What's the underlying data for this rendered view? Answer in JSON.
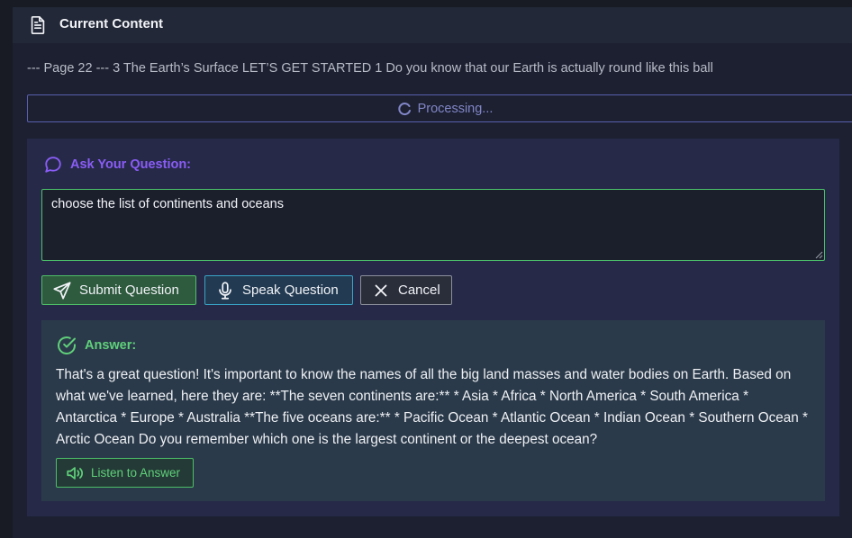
{
  "header": {
    "title": "Current Content",
    "icon": "document-icon"
  },
  "content": {
    "snippet": "--- Page 22 --- 3 The Earth’s Surface LET’S GET STARTED 1 Do you know that our Earth is actually round like this ball"
  },
  "status": {
    "processing_label": "Processing..."
  },
  "question": {
    "label": "Ask Your Question:",
    "value": "choose the list of continents and oceans"
  },
  "buttons": {
    "submit": "Submit Question",
    "speak": "Speak Question",
    "cancel": "Cancel"
  },
  "answer": {
    "label": "Answer:",
    "text": "That's a great question! It's important to know the names of all the big land masses and water bodies on Earth. Based on what we've learned, here they are: **The seven continents are:** * Asia * Africa * North America * South America * Antarctica * Europe * Australia **The five oceans are:** * Pacific Ocean * Atlantic Ocean * Indian Ocean * Southern Ocean * Arctic Ocean Do you remember which one is the largest continent or the deepest ocean?",
    "listen_label": "Listen to Answer"
  },
  "colors": {
    "ask_accent": "#8a5cf6",
    "answer_accent": "#5fd07a",
    "submit_border": "#4fbf68",
    "speak_border": "#3aa3c7",
    "processing_border": "#5a5fb0"
  }
}
